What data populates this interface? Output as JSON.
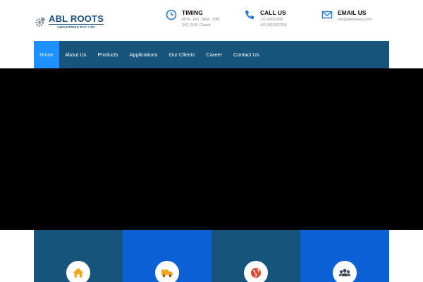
{
  "brand": {
    "title": "ABL ROOTS",
    "subtitle": "INDUSTRIES PVT LTD"
  },
  "contact": {
    "timing": {
      "title": "TIMING",
      "line1": "MON - FRI : 9AM - 7PM",
      "line2": "SAT, SUN: Closed",
      "icon": "clock-icon"
    },
    "call": {
      "title": "CALL US",
      "line1": "+11 43691368",
      "line2": "+91 9910022939",
      "icon": "phone-icon"
    },
    "email": {
      "title": "EMAIL US",
      "line1": "info@ablblowers.com",
      "icon": "envelope-icon"
    }
  },
  "nav": {
    "items": [
      {
        "label": "Home"
      },
      {
        "label": "About Us"
      },
      {
        "label": "Products"
      },
      {
        "label": "Applications"
      },
      {
        "label": "Our Clients"
      },
      {
        "label": "Career"
      },
      {
        "label": "Contact Us"
      }
    ]
  },
  "features": [
    {
      "icon": "home-icon"
    },
    {
      "icon": "truck-icon"
    },
    {
      "icon": "globe-icon"
    },
    {
      "icon": "users-icon"
    }
  ],
  "colors": {
    "nav_bg": "#18547b",
    "nav_active": "#1e90ff",
    "feature_blue": "#0a62d6",
    "icon_blue": "#1e7bd9",
    "icon_orange": "#f5a623",
    "icon_red": "#e04a2e",
    "icon_dark": "#3b4c5c"
  }
}
